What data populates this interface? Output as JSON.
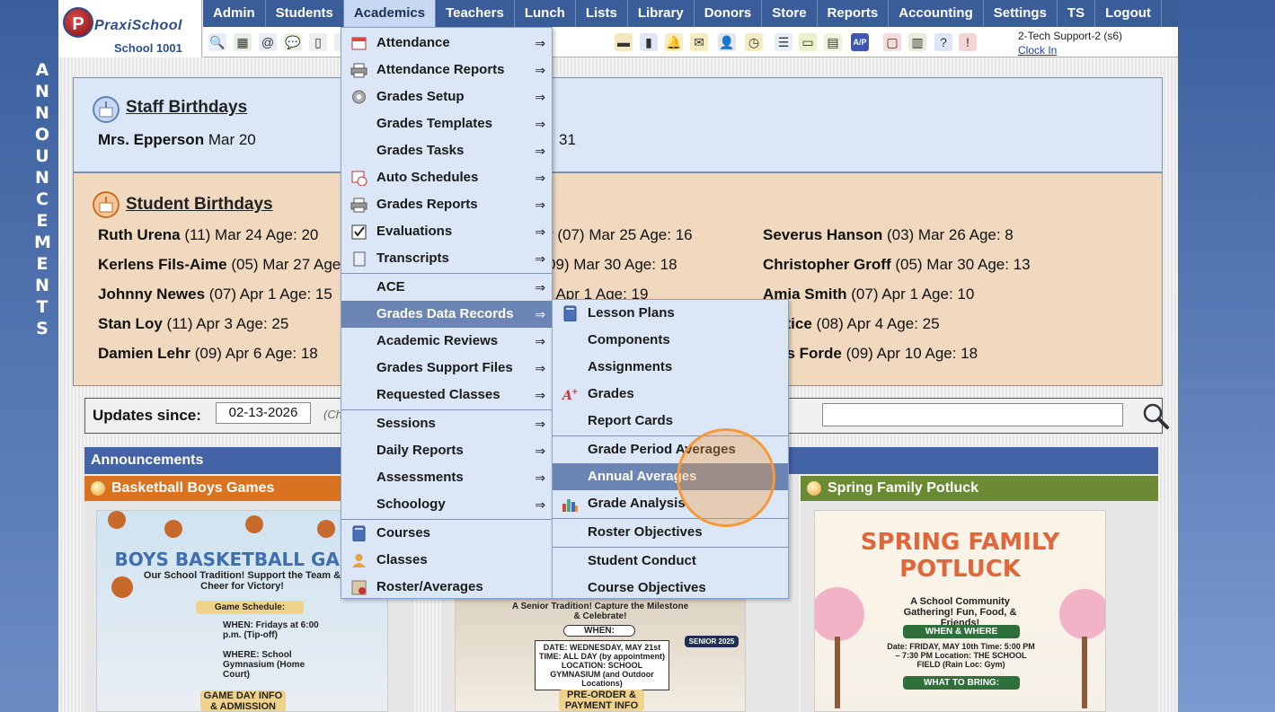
{
  "side": {
    "vertical_text": "ANNOUNCEMENTS"
  },
  "header": {
    "logo_letter": "P",
    "logo_text": "PraxiSchool",
    "school_name": "School 1001",
    "support_user": "2-Tech Support-2 (s6)",
    "clock_in": "Clock In"
  },
  "menubar": [
    "Admin",
    "Students",
    "Academics",
    "Teachers",
    "Lunch",
    "Lists",
    "Library",
    "Donors",
    "Store",
    "Reports",
    "Accounting",
    "Settings",
    "TS",
    "Logout"
  ],
  "toolbar_icons": [
    "search-icon",
    "calendar-grid-icon",
    "email-icon",
    "chat-icon",
    "phone-icon",
    "speaker-icon",
    "lunch-icon",
    "book-icon",
    "bell-icon",
    "note-icon",
    "person-icon",
    "clock-icon",
    "list-icon",
    "id-card-icon",
    "printer-icon",
    "ap-icon",
    "pdf-icon",
    "money-icon",
    "help-icon",
    "alert-icon"
  ],
  "staff": {
    "title": "Staff Birthdays",
    "entry1_name": "Mrs. Epperson",
    "entry1_date": "Mar 20",
    "entry2_tail": "31"
  },
  "students": {
    "title": "Student Birthdays",
    "col1": [
      {
        "name": "Ruth Urena",
        "rest": "(11) Mar 24 Age: 20"
      },
      {
        "name": "Kerlens Fils-Aime",
        "rest": "(05) Mar 27 Age"
      },
      {
        "name": "Johnny Newes",
        "rest": "(07) Apr 1 Age: 15"
      },
      {
        "name": "Stan Loy",
        "rest": "(11) Apr 3 Age: 25"
      },
      {
        "name": "Damien Lehr",
        "rest": "(09) Apr 6 Age: 18"
      }
    ],
    "col2": [
      {
        "name": "r",
        "rest": "(07) Mar 25 Age: 16"
      },
      {
        "name": "",
        "rest": "09) Mar 30 Age: 18"
      },
      {
        "name": "",
        "rest": ") Apr 1 Age: 19"
      }
    ],
    "col3": [
      {
        "name": "Severus Hanson",
        "rest": "(03) Mar 26 Age: 8"
      },
      {
        "name": "Christopher Groff",
        "rest": "(05) Mar 30 Age: 13"
      },
      {
        "name": "Amia Smith",
        "rest": "(07) Apr 1 Age: 10"
      },
      {
        "name": "Lettice",
        "rest": "(08) Apr 4 Age: 25"
      },
      {
        "name": "dres Forde",
        "rest": "(09) Apr 10 Age: 18"
      }
    ]
  },
  "updates": {
    "label": "Updates since:",
    "date": "02-13-2026",
    "hint": "(Ch"
  },
  "announcements": {
    "header": "Announcements",
    "card1_title": "Basketball Boys Games",
    "card3_title": "Spring Family Potluck",
    "poster1_title": "BOYS BASKETBALL GAME",
    "poster1_sub": "Our School Tradition! Support the Team & Cheer for Victory!",
    "poster1_sched": "Game Schedule:",
    "poster1_when": "WHEN: Fridays at 6:00 p.m. (Tip-off)",
    "poster1_where": "WHERE: School Gymnasium (Home Court)",
    "poster1_info": "GAME DAY INFO & ADMISSION",
    "poster2_sub": "A Senior Tradition! Capture the Milestone & Celebrate!",
    "poster2_when": "WHEN:",
    "poster2_details": "DATE: WEDNESDAY, MAY 21st  TIME: ALL DAY (by appointment)  LOCATION: SCHOOL GYMNASIUM (and Outdoor Locations)",
    "poster2_badge": "SENIOR 2025",
    "poster2_bottom": "PRE-ORDER & PAYMENT INFO",
    "poster3_title": "SPRING FAMILY POTLUCK",
    "poster3_sub": "A School Community Gathering! Fun, Food, & Friends!",
    "poster3_where": "WHEN & WHERE",
    "poster3_details": "Date: FRIDAY, MAY 10th  Time: 5:00 PM – 7:30 PM  Location: THE SCHOOL FIELD (Rain Loc: Gym)",
    "poster3_bring": "WHAT TO BRING:"
  },
  "academics_menu": [
    {
      "label": "Attendance",
      "icon": "calendar-icon",
      "arrow": true
    },
    {
      "label": "Attendance Reports",
      "icon": "printer-icon",
      "arrow": true
    },
    {
      "label": "Grades Setup",
      "icon": "gear-icon",
      "arrow": true
    },
    {
      "label": "Grades Templates",
      "icon": "",
      "arrow": true
    },
    {
      "label": "Grades Tasks",
      "icon": "",
      "arrow": true
    },
    {
      "label": "Auto Schedules",
      "icon": "calendar-clock-icon",
      "arrow": true
    },
    {
      "label": "Grades Reports",
      "icon": "printer-icon",
      "arrow": true
    },
    {
      "label": "Evaluations",
      "icon": "checkbox-icon",
      "arrow": true
    },
    {
      "label": "Transcripts",
      "icon": "scroll-icon",
      "arrow": true
    },
    {
      "label": "ACE",
      "icon": "",
      "arrow": true
    },
    {
      "label": "Grades Data Records",
      "icon": "",
      "arrow": true
    },
    {
      "label": "Academic Reviews",
      "icon": "",
      "arrow": true
    },
    {
      "label": "Grades Support Files",
      "icon": "",
      "arrow": true
    },
    {
      "label": "Requested Classes",
      "icon": "",
      "arrow": true
    },
    {
      "label": "Sessions",
      "icon": "",
      "arrow": true
    },
    {
      "label": "Daily Reports",
      "icon": "",
      "arrow": true
    },
    {
      "label": "Assessments",
      "icon": "",
      "arrow": true
    },
    {
      "label": "Schoology",
      "icon": "",
      "arrow": true
    },
    {
      "label": "Courses",
      "icon": "book-icon",
      "arrow": false
    },
    {
      "label": "Classes",
      "icon": "person-icon",
      "arrow": false
    },
    {
      "label": "Roster/Averages",
      "icon": "roster-icon",
      "arrow": false
    }
  ],
  "arrow_glyph": "⇒",
  "grades_data_submenu": [
    {
      "label": "Lesson Plans",
      "icon": "book-icon"
    },
    {
      "label": "Components",
      "icon": ""
    },
    {
      "label": "Assignments",
      "icon": ""
    },
    {
      "label": "Grades",
      "icon": "a-plus-icon"
    },
    {
      "label": "Report Cards",
      "icon": ""
    },
    {
      "label": "Grade Period Averages",
      "icon": ""
    },
    {
      "label": "Annual Averages",
      "icon": ""
    },
    {
      "label": "Grade Analysis",
      "icon": "bar-chart-icon"
    },
    {
      "label": "Roster Objectives",
      "icon": ""
    },
    {
      "label": "Student Conduct",
      "icon": ""
    },
    {
      "label": "Course Objectives",
      "icon": ""
    }
  ],
  "colors": {
    "menubar": "#3a5d9a",
    "menu_highlight": "#6b85b5",
    "staff_panel": "#dbe7f6",
    "student_panel": "#f0d9bf",
    "card1_header": "#d9731f",
    "card3_header": "#6a8a33",
    "ring": "#f59a3a"
  }
}
